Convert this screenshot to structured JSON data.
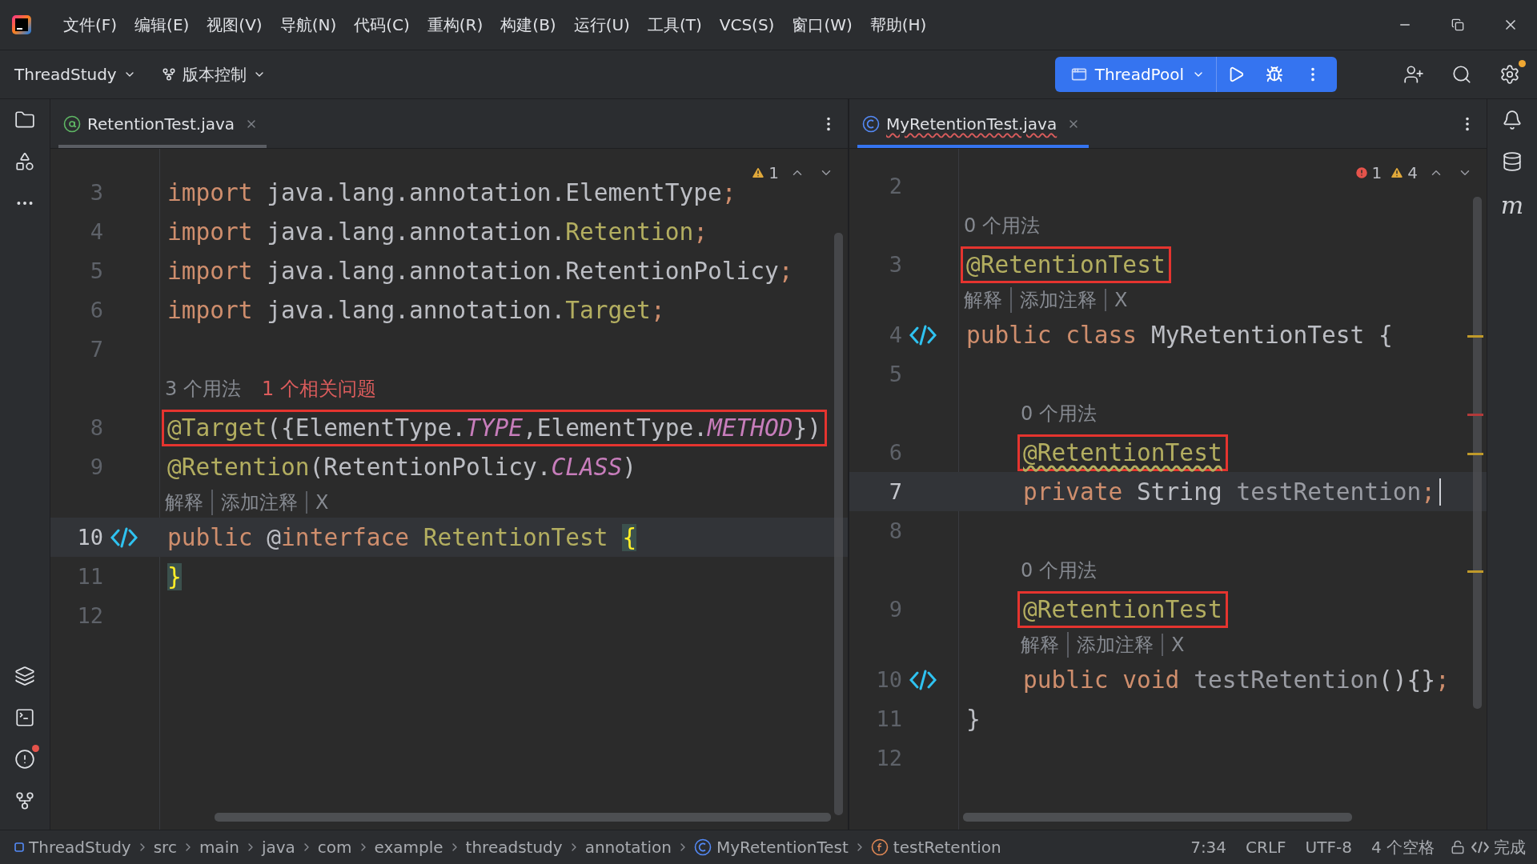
{
  "menu": [
    {
      "label": "文件(F)"
    },
    {
      "label": "编辑(E)"
    },
    {
      "label": "视图(V)"
    },
    {
      "label": "导航(N)"
    },
    {
      "label": "代码(C)"
    },
    {
      "label": "重构(R)"
    },
    {
      "label": "构建(B)"
    },
    {
      "label": "运行(U)"
    },
    {
      "label": "工具(T)"
    },
    {
      "label": "VCS(S)"
    },
    {
      "label": "窗口(W)"
    },
    {
      "label": "帮助(H)"
    }
  ],
  "toolbar": {
    "project": "ThreadStudy",
    "vcs": "版本控制",
    "run_config": "ThreadPool",
    "settings_badge": true
  },
  "left_stripe": [
    {
      "kind": "folder",
      "alert": false
    },
    {
      "kind": "structure",
      "alert": false
    },
    {
      "kind": "more",
      "alert": false
    },
    {
      "kind": "layers",
      "alert": false
    },
    {
      "kind": "terminal",
      "alert": false
    },
    {
      "kind": "problems",
      "alert": true
    },
    {
      "kind": "git",
      "alert": false
    }
  ],
  "right_stripe": [
    {
      "kind": "bell"
    },
    {
      "kind": "database"
    },
    {
      "kind": "text",
      "text": "m"
    }
  ],
  "editors": [
    {
      "focused": false,
      "tab": {
        "title": "RetentionTest.java",
        "kind": "annotation",
        "selected": true,
        "error": false
      },
      "inspections": [
        {
          "kind": "warning",
          "count": "1"
        }
      ],
      "rows": [
        {
          "kind": "code",
          "number": "3",
          "current": false,
          "boxed": false,
          "tokens": [
            {
              "text": "import",
              "kind": "keyword"
            },
            {
              "text": " java.lang.annotation.ElementType",
              "kind": "plain"
            },
            {
              "text": ";",
              "kind": "keyword"
            }
          ]
        },
        {
          "kind": "code",
          "number": "4",
          "current": false,
          "boxed": false,
          "tokens": [
            {
              "text": "import",
              "kind": "keyword"
            },
            {
              "text": " java.lang.annotation.",
              "kind": "plain"
            },
            {
              "text": "Retention",
              "kind": "annotation"
            },
            {
              "text": ";",
              "kind": "keyword"
            }
          ]
        },
        {
          "kind": "code",
          "number": "5",
          "current": false,
          "boxed": false,
          "tokens": [
            {
              "text": "import",
              "kind": "keyword"
            },
            {
              "text": " java.lang.annotation.RetentionPolicy",
              "kind": "plain"
            },
            {
              "text": ";",
              "kind": "keyword"
            }
          ]
        },
        {
          "kind": "code",
          "number": "6",
          "current": false,
          "boxed": false,
          "tokens": [
            {
              "text": "import",
              "kind": "keyword"
            },
            {
              "text": " java.lang.annotation.",
              "kind": "plain"
            },
            {
              "text": "Target",
              "kind": "annotation"
            },
            {
              "text": ";",
              "kind": "keyword"
            }
          ]
        },
        {
          "kind": "code",
          "number": "7",
          "current": false
        },
        {
          "kind": "hint",
          "parts": [
            {
              "text": "3 个用法",
              "kind": "usage"
            },
            {
              "text": "1 个相关问题",
              "kind": "problem"
            }
          ]
        },
        {
          "kind": "code",
          "number": "8",
          "current": false,
          "boxed": true,
          "tokens": [
            {
              "text": "@Target",
              "kind": "annotation"
            },
            {
              "text": "({ElementType.",
              "kind": "plain"
            },
            {
              "text": "TYPE",
              "kind": "constant"
            },
            {
              "text": ",ElementType.",
              "kind": "plain"
            },
            {
              "text": "METHOD",
              "kind": "constant"
            },
            {
              "text": "})",
              "kind": "plain"
            }
          ]
        },
        {
          "kind": "code",
          "number": "9",
          "current": false,
          "boxed": false,
          "tokens": [
            {
              "text": "@Retention",
              "kind": "annotation"
            },
            {
              "text": "(RetentionPolicy.",
              "kind": "plain"
            },
            {
              "text": "CLASS",
              "kind": "constant"
            },
            {
              "text": ")",
              "kind": "plain"
            }
          ]
        },
        {
          "kind": "actions",
          "parts": [
            {
              "text": "解释"
            },
            {
              "text": "添加注释"
            },
            {
              "text": "X"
            }
          ]
        },
        {
          "kind": "code",
          "number": "10",
          "current": true,
          "boxed": false,
          "implemented": true,
          "tokens": [
            {
              "text": "public",
              "kind": "keyword"
            },
            {
              "text": " @",
              "kind": "plain"
            },
            {
              "text": "interface",
              "kind": "keyword"
            },
            {
              "text": " RetentionTest ",
              "kind": "annotation"
            },
            {
              "text": "{",
              "kind": "brace"
            }
          ]
        },
        {
          "kind": "code",
          "number": "11",
          "current": false,
          "boxed": false,
          "tokens": [
            {
              "text": "}",
              "kind": "brace"
            }
          ]
        },
        {
          "kind": "code",
          "number": "12",
          "current": false
        }
      ]
    },
    {
      "focused": true,
      "tab": {
        "title": "MyRetentionTest.java",
        "kind": "class",
        "selected": true,
        "error": true
      },
      "inspections": [
        {
          "kind": "error",
          "count": "1"
        },
        {
          "kind": "warning",
          "count": "4"
        }
      ],
      "rows": [
        {
          "kind": "code",
          "number": "2",
          "current": false
        },
        {
          "kind": "hint",
          "parts": [
            {
              "text": "0 个用法",
              "kind": "usage"
            }
          ]
        },
        {
          "kind": "code",
          "number": "3",
          "current": false,
          "boxed": true,
          "tokens": [
            {
              "text": "@RetentionTest",
              "kind": "annotation"
            }
          ]
        },
        {
          "kind": "actions",
          "parts": [
            {
              "text": "解释"
            },
            {
              "text": "添加注释"
            },
            {
              "text": "X"
            }
          ]
        },
        {
          "kind": "code",
          "number": "4",
          "current": false,
          "boxed": false,
          "implemented": true,
          "color": "#c09a2a",
          "tokens": [
            {
              "text": "public class",
              "kind": "keyword"
            },
            {
              "text": " MyRetentionTest {",
              "kind": "plain"
            }
          ],
          "children": [
            {
              "kind": "code",
              "number": "5",
              "current": false
            },
            {
              "kind": "hint",
              "color": "#b33a3a",
              "parts": [
                {
                  "text": "0 个用法",
                  "kind": "usage"
                }
              ]
            },
            {
              "kind": "code",
              "number": "6",
              "current": false,
              "boxed": true,
              "color": "#c09a2a",
              "tokens": [
                {
                  "text": "@RetentionTest",
                  "kind": "annotation",
                  "warning": true
                }
              ]
            },
            {
              "kind": "code",
              "number": "7",
              "current": true,
              "boxed": false,
              "caret": true,
              "tokens": [
                {
                  "text": "private",
                  "kind": "keyword"
                },
                {
                  "text": " String ",
                  "kind": "plain"
                },
                {
                  "text": "testRetention",
                  "kind": "unused"
                },
                {
                  "text": ";",
                  "kind": "keyword"
                }
              ]
            },
            {
              "kind": "code",
              "number": "8",
              "current": false
            },
            {
              "kind": "hint",
              "color": "#c09a2a",
              "parts": [
                {
                  "text": "0 个用法",
                  "kind": "usage"
                }
              ]
            },
            {
              "kind": "code",
              "number": "9",
              "current": false,
              "boxed": true,
              "tokens": [
                {
                  "text": "@RetentionTest",
                  "kind": "annotation"
                }
              ]
            },
            {
              "kind": "actions",
              "parts": [
                {
                  "text": "解释"
                },
                {
                  "text": "添加注释"
                },
                {
                  "text": "X"
                }
              ]
            },
            {
              "kind": "code",
              "number": "10",
              "current": false,
              "boxed": false,
              "implemented": true,
              "tokens": [
                {
                  "text": "public void ",
                  "kind": "keyword"
                },
                {
                  "text": "testRetention",
                  "kind": "unused"
                },
                {
                  "text": "(){}",
                  "kind": "plain"
                },
                {
                  "text": ";",
                  "kind": "keyword"
                }
              ]
            }
          ]
        },
        {
          "kind": "code",
          "number": "11",
          "current": false,
          "boxed": false,
          "tokens": [
            {
              "text": "}",
              "kind": "plain"
            }
          ]
        },
        {
          "kind": "code",
          "number": "12",
          "current": false
        }
      ]
    }
  ],
  "breadcrumbs": [
    {
      "text": "ThreadStudy",
      "kind": "module"
    },
    {
      "text": "src",
      "kind": "folder"
    },
    {
      "text": "main",
      "kind": "folder"
    },
    {
      "text": "java",
      "kind": "folder"
    },
    {
      "text": "com",
      "kind": "folder"
    },
    {
      "text": "example",
      "kind": "folder"
    },
    {
      "text": "threadstudy",
      "kind": "folder"
    },
    {
      "text": "annotation",
      "kind": "folder"
    },
    {
      "text": "MyRetentionTest",
      "kind": "class"
    },
    {
      "text": "testRetention",
      "kind": "field"
    }
  ],
  "status": {
    "position": "7:34",
    "line_ending": "CRLF",
    "encoding": "UTF-8",
    "indent": "4 个空格",
    "done": "完成"
  }
}
